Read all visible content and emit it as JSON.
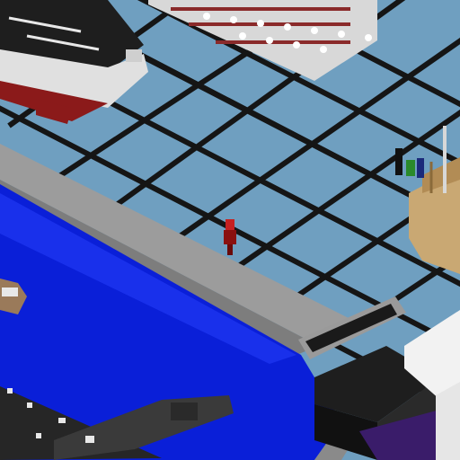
{
  "colors": {
    "floor_tile": "#6f9fc0",
    "grid_line": "#151515",
    "wall_top": "#9c9c9c",
    "wall_face": "#7d7d7d",
    "water_deep": "#0a1fd8",
    "water_light": "#1d35f0",
    "ship_white": "#e8e8e8",
    "ship_black": "#1e1e1e",
    "ship_red": "#8b1a1a",
    "wood": "#c9a873",
    "dark_block": "#222222",
    "white_block": "#f2f2f2",
    "purple_block": "#3a1c6a",
    "figure_red": "#c62020"
  },
  "scene_objects": [
    "aircraft-carrier-model",
    "pipe-rack-structure",
    "wooden-sailing-ship",
    "red-player-figure",
    "submarine-model",
    "small-boat-model",
    "black-machinery-block",
    "vent-grate",
    "white-building-corner"
  ]
}
